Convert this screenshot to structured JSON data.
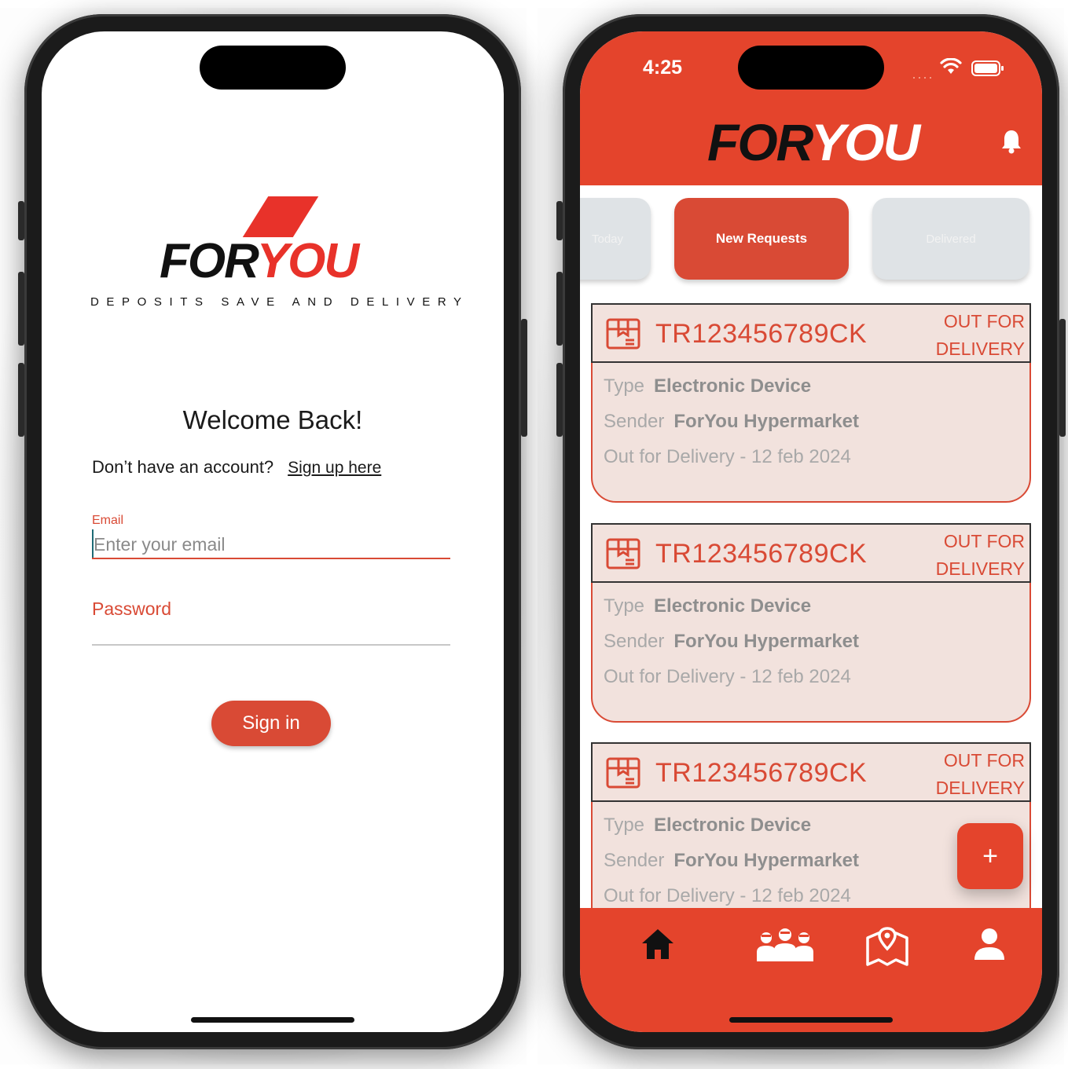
{
  "login": {
    "logo_part1": "FOR",
    "logo_part2": "YOU",
    "tagline": "DEPOSITS SAVE AND DELIVERY",
    "welcome": "Welcome Back!",
    "no_account": "Don’t have an account?",
    "signup_link": "Sign up here",
    "email_label": "Email",
    "email_placeholder": "Enter your email",
    "password_label": "Password",
    "signin_label": "Sign in"
  },
  "app": {
    "status_time": "4:25",
    "logo_part1": "FOR",
    "logo_part2": "YOU",
    "tabs": [
      {
        "label": "Today"
      },
      {
        "label": "New Requests"
      },
      {
        "label": "Delivered"
      }
    ],
    "shipments": [
      {
        "tracking": "TR123456789CK",
        "status_line1": "OUT FOR",
        "status_line2": "DELIVERY",
        "type_label": "Type",
        "type_value": "Electronic Device",
        "sender_label": "Sender",
        "sender_value": "ForYou Hypermarket",
        "delivery": "Out for Delivery - 12 feb 2024"
      },
      {
        "tracking": "TR123456789CK",
        "status_line1": "OUT FOR",
        "status_line2": "DELIVERY",
        "type_label": "Type",
        "type_value": "Electronic Device",
        "sender_label": "Sender",
        "sender_value": "ForYou Hypermarket",
        "delivery": "Out for Delivery - 12 feb 2024"
      },
      {
        "tracking": "TR123456789CK",
        "status_line1": "OUT FOR",
        "status_line2": "DELIVERY",
        "type_label": "Type",
        "type_value": "Electronic Device",
        "sender_label": "Sender",
        "sender_value": "ForYou Hypermarket",
        "delivery": "Out for Delivery - 12 feb 2024"
      }
    ],
    "fab_label": "+",
    "nav_icons": [
      "home-icon",
      "team-icon",
      "map-icon",
      "profile-icon"
    ]
  },
  "colors": {
    "brand_red": "#e4442c",
    "accent_red": "#d94a35",
    "card_bg": "#f2e2dd",
    "tab_inactive": "#dfe3e6"
  }
}
